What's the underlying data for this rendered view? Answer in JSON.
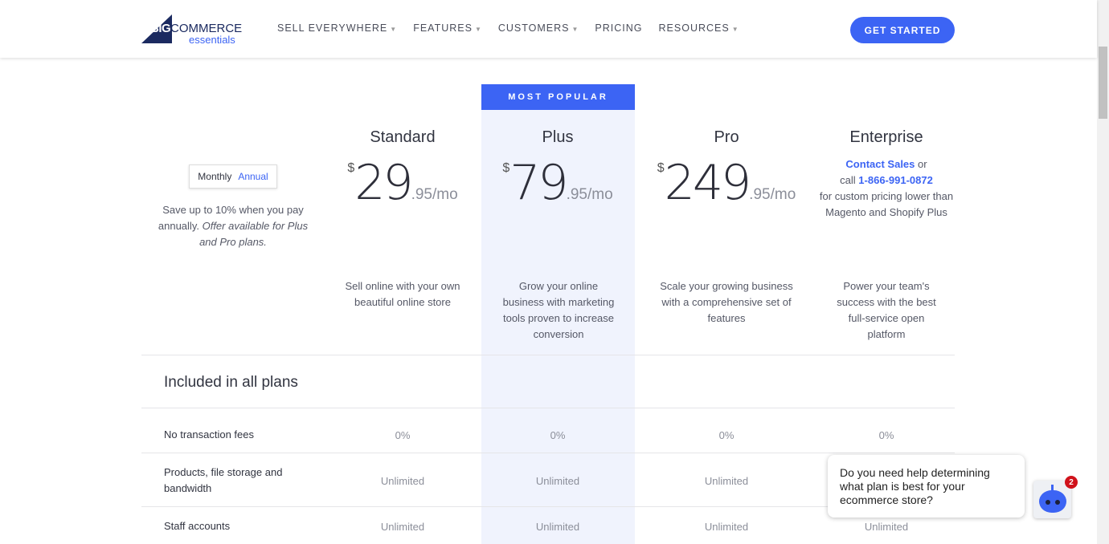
{
  "header": {
    "logo_text": "BIGCOMMERCE essentials",
    "nav": [
      "SELL EVERYWHERE",
      "FEATURES",
      "CUSTOMERS",
      "PRICING",
      "RESOURCES"
    ],
    "cta": "GET STARTED"
  },
  "badge_popular": "MOST POPULAR",
  "billing": {
    "monthly": "Monthly",
    "annual": "Annual",
    "note_1": "Save up to 10% when you pay annually.",
    "note_2": "Offer available for Plus and Pro plans."
  },
  "plans": [
    {
      "name": "Standard",
      "currency": "$",
      "amount": "29",
      "cents": ".95/mo",
      "desc": "Sell online with your own beautiful online store"
    },
    {
      "name": "Plus",
      "currency": "$",
      "amount": "79",
      "cents": ".95/mo",
      "desc": "Grow your online business with marketing tools proven to increase conversion"
    },
    {
      "name": "Pro",
      "currency": "$",
      "amount": "249",
      "cents": ".95/mo",
      "desc": "Scale your growing business with a comprehensive set of features"
    },
    {
      "name": "Enterprise",
      "contact": "Contact Sales",
      "or": " or",
      "call": "call ",
      "phone": "1-866-991-0872",
      "pricing_note": "for custom pricing lower than Magento and Shopify Plus",
      "desc": "Power your team's success with the best full-service open platform"
    }
  ],
  "included_title": "Included in all plans",
  "rows": [
    {
      "label": "No transaction fees",
      "values": [
        "0%",
        "0%",
        "0%",
        "0%"
      ]
    },
    {
      "label": "Products, file storage and bandwidth",
      "values": [
        "Unlimited",
        "Unlimited",
        "Unlimited",
        ""
      ]
    },
    {
      "label": "Staff accounts",
      "values": [
        "Unlimited",
        "Unlimited",
        "Unlimited",
        "Unlimited"
      ]
    }
  ],
  "chat": {
    "message": "Do you need help determining what plan is best for your ecommerce store?",
    "unread": "2"
  }
}
